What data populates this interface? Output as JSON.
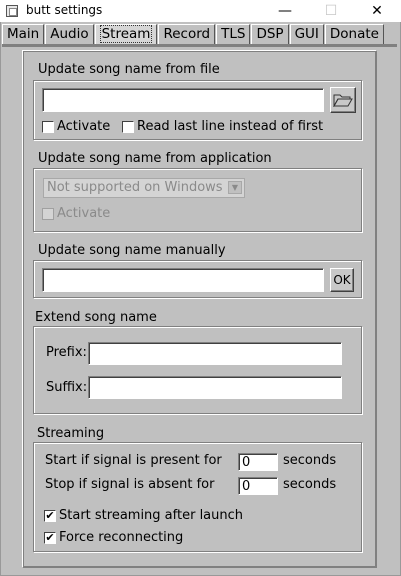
{
  "window": {
    "title": "butt settings",
    "minimize": "—",
    "maximize": "☐",
    "close": "✕"
  },
  "tabs": [
    "Main",
    "Audio",
    "Stream",
    "Record",
    "TLS",
    "DSP",
    "GUI",
    "Donate"
  ],
  "active_tab": "Stream",
  "file_section": {
    "title": "Update song name from file",
    "path_value": "",
    "activate_label": "Activate",
    "activate_checked": false,
    "read_last_line_label": "Read last line instead of first",
    "read_last_line_checked": false
  },
  "app_section": {
    "title": "Update song name from application",
    "select_value": "Not supported on Windows",
    "activate_label": "Activate",
    "activate_checked": false
  },
  "manual_section": {
    "title": "Update song name manually",
    "value": "",
    "ok_label": "OK"
  },
  "extend_section": {
    "title": "Extend song name",
    "prefix_label": "Prefix:",
    "prefix_value": "",
    "suffix_label": "Suffix:",
    "suffix_value": ""
  },
  "streaming_section": {
    "title": "Streaming",
    "start_label": "Start if signal is present for",
    "start_value": "0",
    "start_unit": "seconds",
    "stop_label": "Stop if signal is absent for",
    "stop_value": "0",
    "stop_unit": "seconds",
    "auto_start_label": "Start streaming after launch",
    "auto_start_checked": true,
    "reconnect_label": "Force reconnecting",
    "reconnect_checked": true,
    "check_mark": "✔"
  },
  "colors": {
    "background": "#c0c0c0",
    "disabled_text": "#8a8a8a"
  }
}
